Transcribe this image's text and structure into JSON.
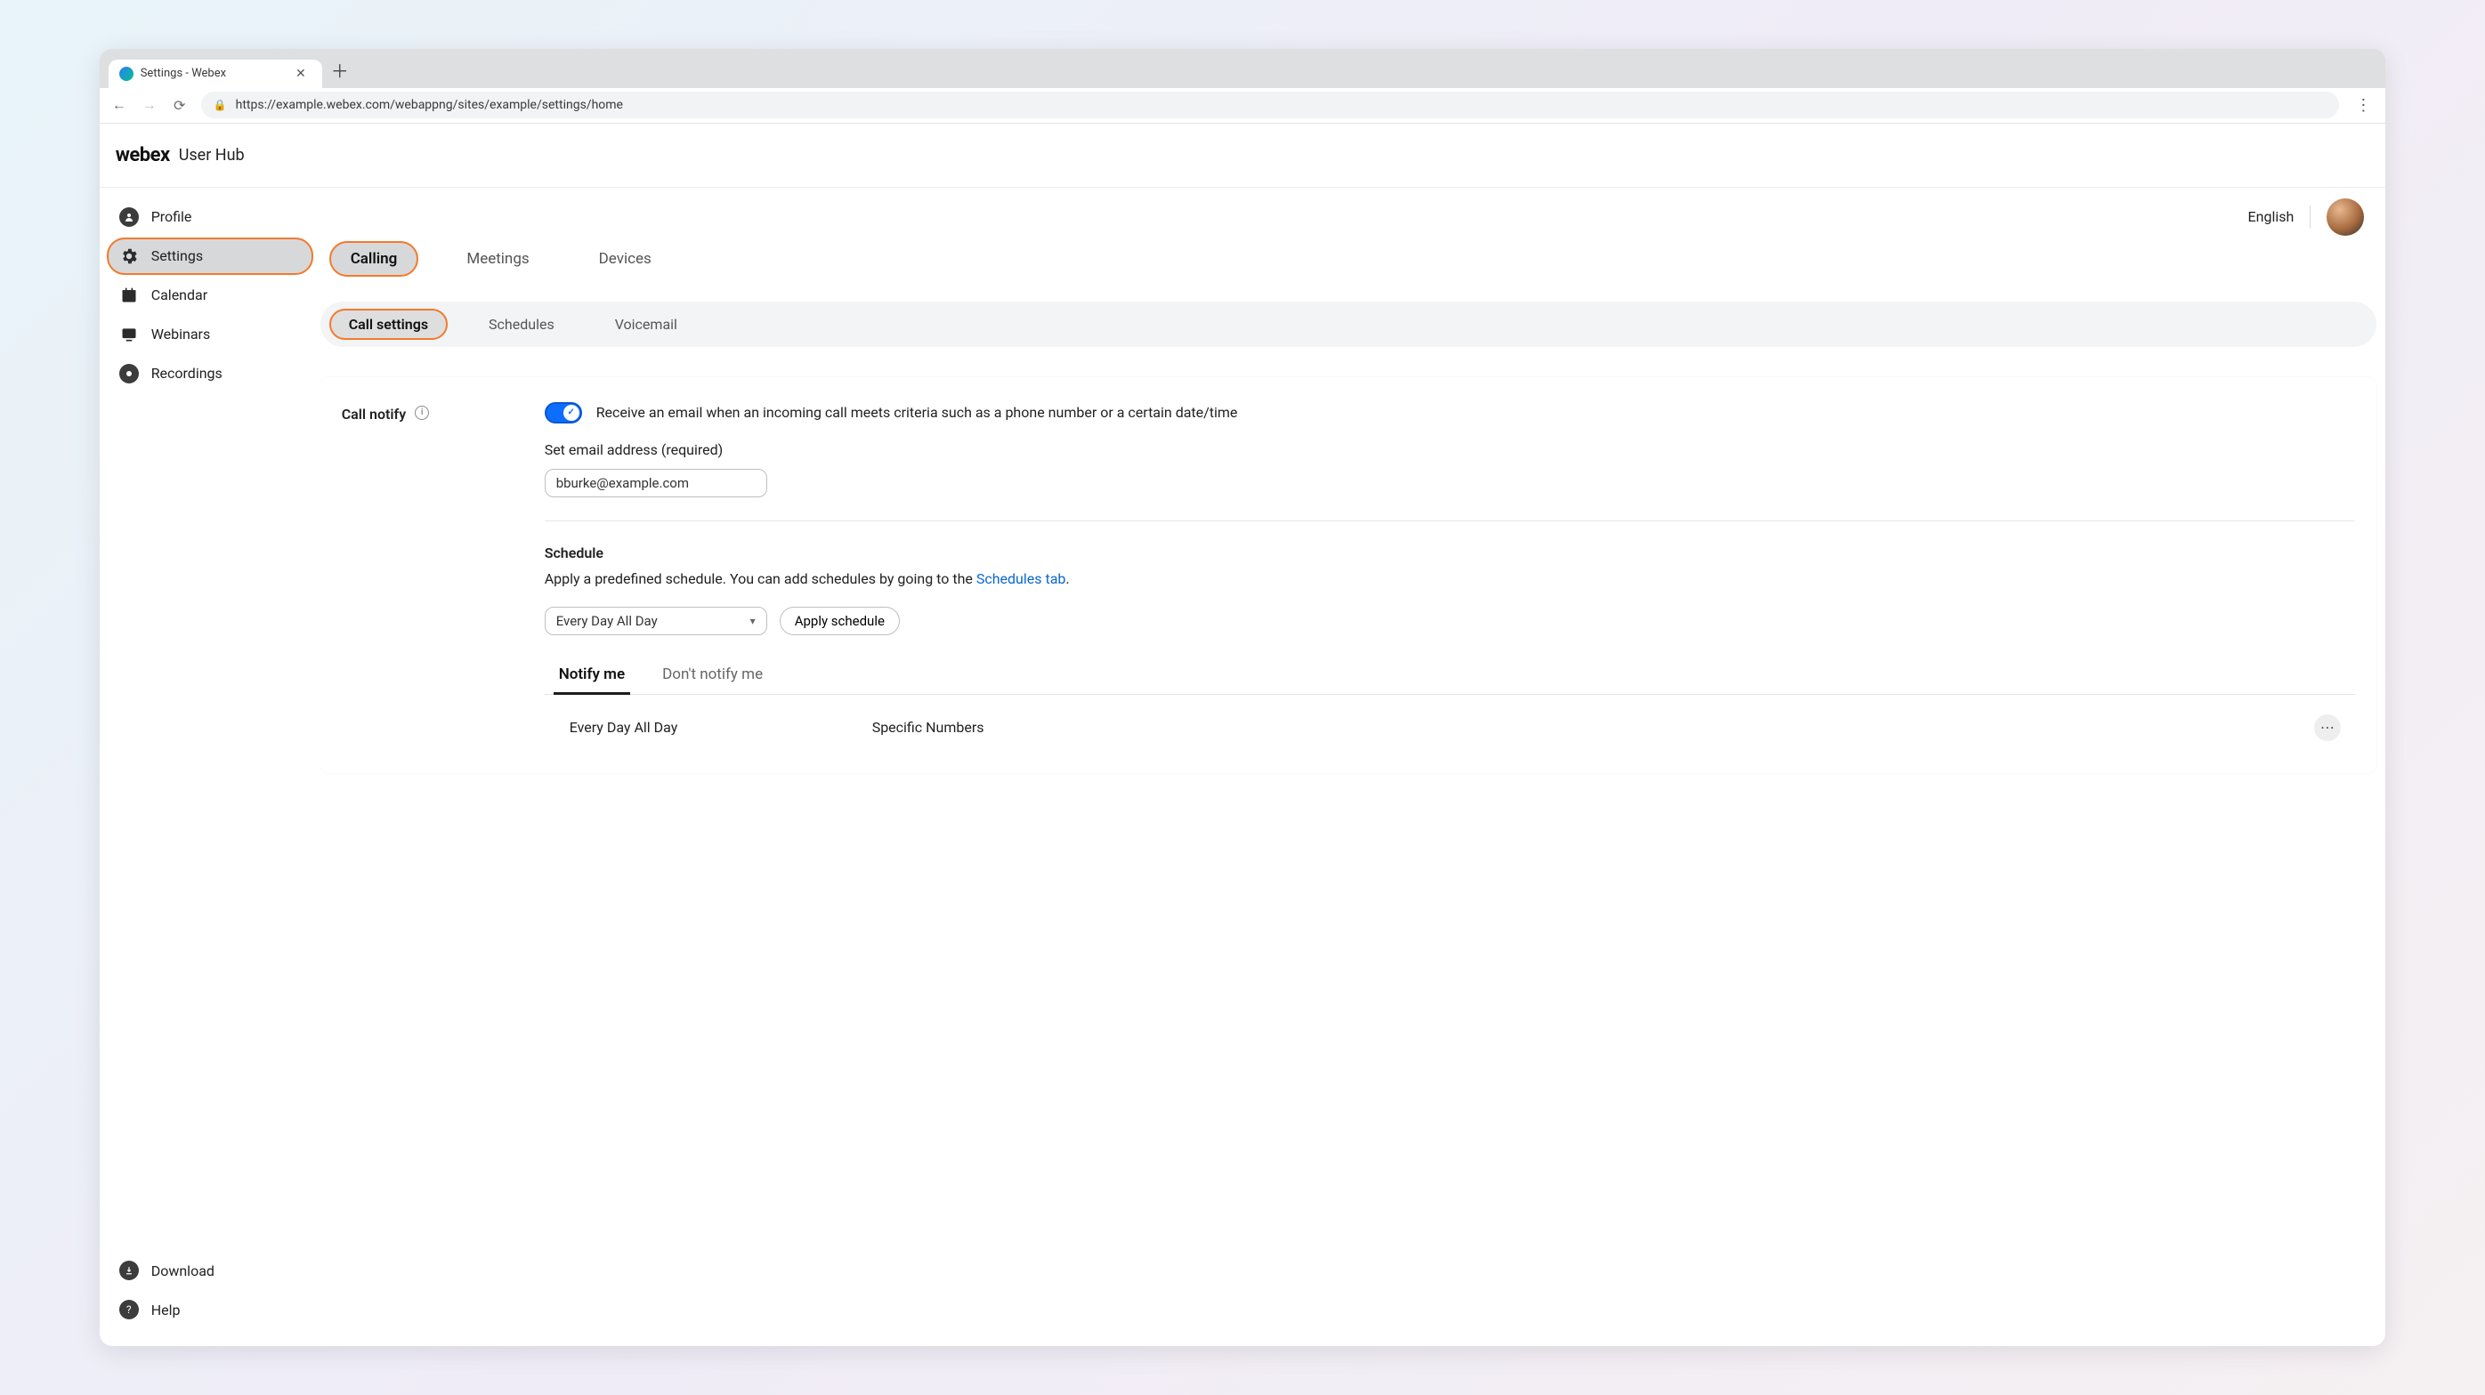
{
  "browser": {
    "tab_title": "Settings - Webex",
    "url": "https://example.webex.com/webappng/sites/example/settings/home"
  },
  "header": {
    "brand": "webex",
    "brand_sub": "User Hub",
    "language": "English"
  },
  "sidebar": {
    "items": [
      {
        "label": "Profile"
      },
      {
        "label": "Settings"
      },
      {
        "label": "Calendar"
      },
      {
        "label": "Webinars"
      },
      {
        "label": "Recordings"
      }
    ],
    "bottom": [
      {
        "label": "Download"
      },
      {
        "label": "Help"
      }
    ]
  },
  "primary_tabs": {
    "items": [
      {
        "label": "Calling"
      },
      {
        "label": "Meetings"
      },
      {
        "label": "Devices"
      }
    ]
  },
  "secondary_tabs": {
    "items": [
      {
        "label": "Call settings"
      },
      {
        "label": "Schedules"
      },
      {
        "label": "Voicemail"
      }
    ]
  },
  "call_notify": {
    "title": "Call notify",
    "description": "Receive an email when an incoming call meets criteria such as a phone number or a certain date/time",
    "email_label": "Set email address (required)",
    "email_value": "bburke@example.com",
    "schedule_title": "Schedule",
    "schedule_desc_before": "Apply a predefined schedule. You can add schedules by going to the ",
    "schedule_desc_link": "Schedules tab",
    "schedule_desc_after": ".",
    "schedule_selected": "Every Day All Day",
    "apply_btn": "Apply schedule",
    "notify_tabs": [
      {
        "label": "Notify me"
      },
      {
        "label": "Don't notify me"
      }
    ],
    "table_row": {
      "col1": "Every Day All Day",
      "col2": "Specific Numbers"
    }
  }
}
